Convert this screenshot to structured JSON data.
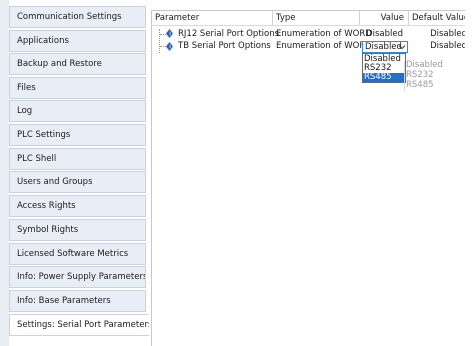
{
  "sidebar": {
    "items": [
      {
        "label": "Communication Settings",
        "active": false
      },
      {
        "label": "Applications",
        "active": false
      },
      {
        "label": "Backup and Restore",
        "active": false
      },
      {
        "label": "Files",
        "active": false
      },
      {
        "label": "Log",
        "active": false
      },
      {
        "label": "PLC Settings",
        "active": false
      },
      {
        "label": "PLC Shell",
        "active": false
      },
      {
        "label": "Users and Groups",
        "active": false
      },
      {
        "label": "Access Rights",
        "active": false
      },
      {
        "label": "Symbol Rights",
        "active": false
      },
      {
        "label": "Licensed Software Metrics",
        "active": false
      },
      {
        "label": "Info: Power Supply Parameters",
        "active": false
      },
      {
        "label": "Info: Base Parameters",
        "active": false
      },
      {
        "label": "Settings: Serial Port Parameters",
        "active": true
      }
    ]
  },
  "grid": {
    "columns": {
      "parameter": "Parameter",
      "type": "Type",
      "value": "Value",
      "default_value": "Default Value"
    },
    "rows": [
      {
        "icon": "parameter-diamond-icon",
        "parameter": "RJ12 Serial Port Options",
        "type": "Enumeration of WORD",
        "value": "Disabled",
        "default_value": "Disabled"
      },
      {
        "icon": "parameter-diamond-icon",
        "parameter": "TB Serial Port Options",
        "type": "Enumeration of WORD",
        "value": "Disabled",
        "default_value": "Disabled"
      }
    ]
  },
  "combo": {
    "value": "Disabled",
    "options": [
      "Disabled",
      "RS232",
      "RS485"
    ],
    "highlighted_option": "RS485",
    "arrow_icon": "chevron-down-icon"
  },
  "ghost_list": {
    "options": [
      "Disabled",
      "RS232",
      "RS485"
    ]
  },
  "colors": {
    "selection": "#1e6fd0",
    "focus_border": "#3b8ad6",
    "nav_background": "#e9eef6",
    "icon_blue": "#2a5fb0"
  }
}
